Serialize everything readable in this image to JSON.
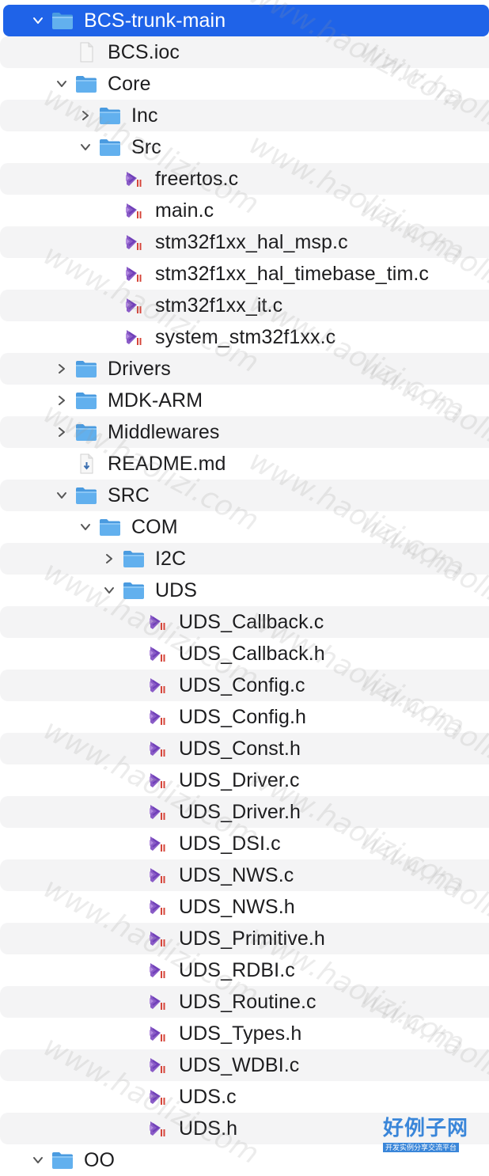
{
  "window": {
    "title": "BCS-trunk-main"
  },
  "watermark": {
    "text": "www.haolizi.com"
  },
  "logo": {
    "title": "好例子网",
    "subtitle": "开发实例分享交流平台"
  },
  "colors": {
    "selection": "#1f63e8",
    "folder": "#5aa8e8",
    "stripe": "#f4f4f5"
  },
  "tree": [
    {
      "label": "BCS-trunk-main",
      "depth": 0,
      "kind": "folder",
      "expanded": true,
      "selected": true
    },
    {
      "label": "BCS.ioc",
      "depth": 1,
      "kind": "doc"
    },
    {
      "label": "Core",
      "depth": 1,
      "kind": "folder",
      "expanded": true
    },
    {
      "label": "Inc",
      "depth": 2,
      "kind": "folder",
      "expanded": false
    },
    {
      "label": "Src",
      "depth": 2,
      "kind": "folder",
      "expanded": true
    },
    {
      "label": "freertos.c",
      "depth": 3,
      "kind": "vs"
    },
    {
      "label": "main.c",
      "depth": 3,
      "kind": "vs"
    },
    {
      "label": "stm32f1xx_hal_msp.c",
      "depth": 3,
      "kind": "vs"
    },
    {
      "label": "stm32f1xx_hal_timebase_tim.c",
      "depth": 3,
      "kind": "vs"
    },
    {
      "label": "stm32f1xx_it.c",
      "depth": 3,
      "kind": "vs"
    },
    {
      "label": "system_stm32f1xx.c",
      "depth": 3,
      "kind": "vs"
    },
    {
      "label": "Drivers",
      "depth": 1,
      "kind": "folder",
      "expanded": false
    },
    {
      "label": "MDK-ARM",
      "depth": 1,
      "kind": "folder",
      "expanded": false
    },
    {
      "label": "Middlewares",
      "depth": 1,
      "kind": "folder",
      "expanded": false
    },
    {
      "label": "README.md",
      "depth": 1,
      "kind": "md"
    },
    {
      "label": "SRC",
      "depth": 1,
      "kind": "folder",
      "expanded": true
    },
    {
      "label": "COM",
      "depth": 2,
      "kind": "folder",
      "expanded": true
    },
    {
      "label": "I2C",
      "depth": 3,
      "kind": "folder",
      "expanded": false
    },
    {
      "label": "UDS",
      "depth": 3,
      "kind": "folder",
      "expanded": true
    },
    {
      "label": "UDS_Callback.c",
      "depth": 4,
      "kind": "vs"
    },
    {
      "label": "UDS_Callback.h",
      "depth": 4,
      "kind": "vs"
    },
    {
      "label": "UDS_Config.c",
      "depth": 4,
      "kind": "vs"
    },
    {
      "label": "UDS_Config.h",
      "depth": 4,
      "kind": "vs"
    },
    {
      "label": "UDS_Const.h",
      "depth": 4,
      "kind": "vs"
    },
    {
      "label": "UDS_Driver.c",
      "depth": 4,
      "kind": "vs"
    },
    {
      "label": "UDS_Driver.h",
      "depth": 4,
      "kind": "vs"
    },
    {
      "label": "UDS_DSI.c",
      "depth": 4,
      "kind": "vs"
    },
    {
      "label": "UDS_NWS.c",
      "depth": 4,
      "kind": "vs"
    },
    {
      "label": "UDS_NWS.h",
      "depth": 4,
      "kind": "vs"
    },
    {
      "label": "UDS_Primitive.h",
      "depth": 4,
      "kind": "vs"
    },
    {
      "label": "UDS_RDBI.c",
      "depth": 4,
      "kind": "vs"
    },
    {
      "label": "UDS_Routine.c",
      "depth": 4,
      "kind": "vs"
    },
    {
      "label": "UDS_Types.h",
      "depth": 4,
      "kind": "vs"
    },
    {
      "label": "UDS_WDBI.c",
      "depth": 4,
      "kind": "vs"
    },
    {
      "label": "UDS.c",
      "depth": 4,
      "kind": "vs"
    },
    {
      "label": "UDS.h",
      "depth": 4,
      "kind": "vs"
    },
    {
      "label": "OO",
      "depth": 0,
      "kind": "folder",
      "expanded": true
    }
  ]
}
